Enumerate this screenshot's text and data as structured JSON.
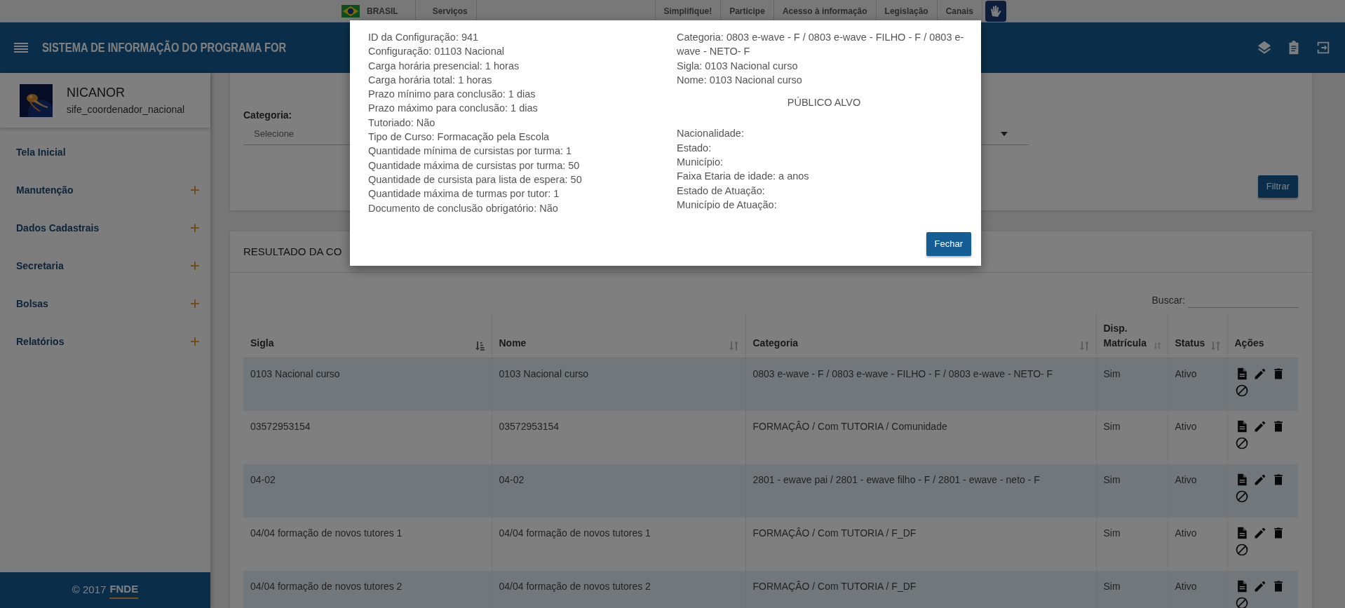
{
  "gov_bar": {
    "country": "BRASIL",
    "services": "Serviços",
    "links": [
      "Simplifique!",
      "Participe",
      "Acesso à informação",
      "Legislação",
      "Canais"
    ]
  },
  "header": {
    "title": "SISTEMA DE INFORMAÇÃO DO PROGRAMA FOR"
  },
  "user": {
    "name": "NICANOR",
    "role": "sife_coordenador_nacional"
  },
  "sidebar": {
    "items": [
      {
        "label": "Tela Inicial",
        "expandable": false
      },
      {
        "label": "Manutenção",
        "expandable": true
      },
      {
        "label": "Dados Cadastrais",
        "expandable": true
      },
      {
        "label": "Secretaria",
        "expandable": true
      },
      {
        "label": "Bolsas",
        "expandable": true
      },
      {
        "label": "Relatórios",
        "expandable": true
      }
    ]
  },
  "footer": {
    "copyright": "© 2017",
    "brand": "FNDE"
  },
  "filter": {
    "label": "Categoria:",
    "value": "Selecione",
    "button": "Filtrar"
  },
  "results": {
    "title": "RESULTADO DA CO",
    "search_label": "Buscar:",
    "columns": [
      {
        "label": "Sigla",
        "sortable": true,
        "sorted": true
      },
      {
        "label": "Nome",
        "sortable": true,
        "sorted": false
      },
      {
        "label": "Categoria",
        "sortable": true,
        "sorted": false
      },
      {
        "label": "Disp. Matrícula",
        "sortable": true,
        "sorted": false
      },
      {
        "label": "Status",
        "sortable": true,
        "sorted": false
      },
      {
        "label": "Ações",
        "sortable": false
      }
    ],
    "rows": [
      {
        "cells": [
          "0103 Nacional curso",
          "0103 Nacional curso",
          "0803 e-wave - F / 0803 e-wave - FILHO - F / 0803 e-wave - NETO- F",
          "Sim",
          "Ativo"
        ]
      },
      {
        "cells": [
          "03572953154",
          "03572953154",
          "FORMAÇÂO / Com TUTORIA / Comunidade",
          "Sim",
          "Ativo"
        ]
      },
      {
        "cells": [
          "04-02",
          "04-02",
          "2801 - ewave pai / 2801 - ewave filho - F / 2801 - ewave - neto - F",
          "Sim",
          "Ativo"
        ]
      },
      {
        "cells": [
          "04/04 formação de novos tutores 1",
          "04/04 formação de novos tutores 1",
          "FORMAÇÂO / Com TUTORIA / F_DF",
          "Sim",
          "Ativo"
        ]
      },
      {
        "cells": [
          "04/04 formação de novos tutores 2",
          "04/04 formação de novos tutores 2",
          "FORMAÇÂO / Com TUTORIA / F_DF",
          "Sim",
          "Ativo"
        ]
      }
    ]
  },
  "modal": {
    "left_lines": [
      "ID da Configuração: 941",
      "Configuração: 01103 Nacional",
      "Carga horária presencial: 1 horas",
      "Carga horária total: 1 horas",
      "Prazo mínimo para conclusão: 1 dias",
      "Prazo máximo para conclusão: 1 dias",
      "Tutoriado: Não",
      "Tipo de Curso: Formacação pela Escola",
      "Quantidade mínima de cursistas por turma: 1",
      "Quantidade máxima de cursistas por turma: 50",
      "Quantidade de cursista para lista de espera: 50",
      "Quantidade máxima de turmas por tutor: 1",
      "Documento de conclusão obrigatório: Não"
    ],
    "right_lines": [
      "Categoria: 0803 e-wave - F / 0803 e-wave - FILHO - F / 0803 e-wave - NETO- F",
      "Sigla: 0103 Nacional curso",
      "Nome: 0103 Nacional curso"
    ],
    "section_title": "PÚBLICO ALVO",
    "section_lines": [
      "Nacionalidade:",
      "Estado:",
      "Município:",
      "Faixa Etaria de idade: a anos",
      "Estado de Atuação:",
      "Município de Atuação:"
    ],
    "close_button": "Fechar"
  }
}
